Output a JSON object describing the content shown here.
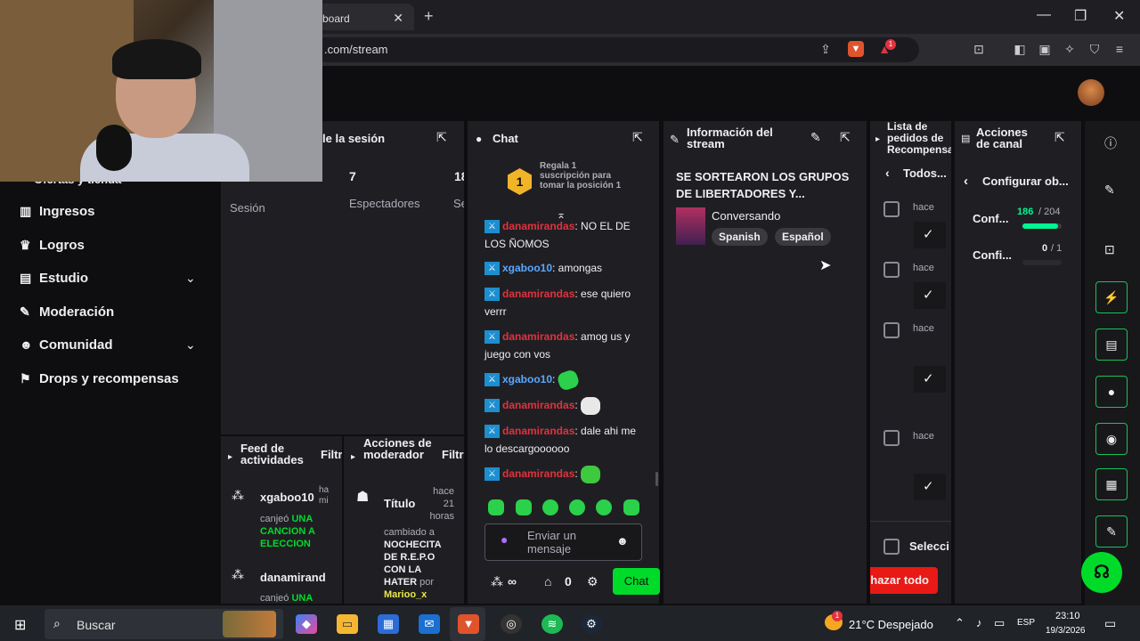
{
  "browser": {
    "tab_title": "board",
    "tab_close": "✕",
    "new_tab": "+",
    "url": ".com/stream",
    "window_controls": [
      "—",
      "❐",
      "✕"
    ],
    "shield_badge": "",
    "alert_badge": "1"
  },
  "sidebar": {
    "cut_item": "Ofertas y tienda",
    "items": [
      {
        "label": "Ingresos",
        "icon": "bar-chart-icon"
      },
      {
        "label": "Logros",
        "icon": "trophy-icon"
      },
      {
        "label": "Estudio",
        "icon": "studio-icon",
        "expandable": true
      },
      {
        "label": "Moderación",
        "icon": "wrench-icon"
      },
      {
        "label": "Comunidad",
        "icon": "community-icon",
        "expandable": true
      },
      {
        "label": "Drops y recompensas",
        "icon": "drops-icon"
      }
    ]
  },
  "session_panel": {
    "title": "le la sesión",
    "stats": [
      {
        "value": "7",
        "label": "Espectadores"
      },
      {
        "value": "18",
        "label": "Se"
      }
    ],
    "label_left": "Sesión"
  },
  "chat_panel": {
    "title": "Chat",
    "gift_text": "Regala 1 suscripción para tomar la posición 1",
    "gift_rank": "1",
    "messages": [
      {
        "user": "danamirandas",
        "text": ": NO EL DE LOS ÑOMOS",
        "color": "red"
      },
      {
        "user": "xgaboo10",
        "text": ": amongas",
        "color": "blue"
      },
      {
        "user": "danamirandas",
        "text": ": ese quiero verrr",
        "color": "red"
      },
      {
        "user": "danamirandas",
        "text": ": amog us y juego con vos",
        "color": "red"
      },
      {
        "user": "xgaboo10",
        "text": ":",
        "color": "blue"
      },
      {
        "user": "danamirandas",
        "text": ":",
        "color": "red"
      },
      {
        "user": "danamirandas",
        "text": ": dale ahi me lo descargoooooo",
        "color": "red"
      },
      {
        "user": "danamirandas",
        "text": ":",
        "color": "red"
      }
    ],
    "input_placeholder": "Enviar un mensaje",
    "points": "∞",
    "store_count": "0",
    "send_label": "Chat"
  },
  "stream_info": {
    "title": "Información del stream",
    "stream_title": "SE SORTEARON LOS GRUPOS DE LIBERTADORES Y...",
    "category": "Conversando",
    "tags": [
      "Spanish",
      "Español"
    ]
  },
  "requests_panel": {
    "title": "Lista de pedidos de Recompensas",
    "filter": "Todos...",
    "rows": [
      "hace",
      "hace",
      "hace",
      "hace"
    ],
    "select_label": "Selecci",
    "reject_all": "hazar todo"
  },
  "channel_actions": {
    "title": "Acciones de canal",
    "back_label": "Configurar ob...",
    "goals": [
      {
        "label": "Conf...",
        "current": "186",
        "total": "/ 204",
        "progress": 0.91
      },
      {
        "label": "Confi...",
        "current": "0",
        "total": "/ 1",
        "progress": 0
      }
    ]
  },
  "activity_feed": {
    "title": "Feed de actividades",
    "filter": "Filtr",
    "items": [
      {
        "user": "xgaboo10",
        "time": "ha mi",
        "action": "canjeó",
        "reward": "UNA CANCION A ELECCION"
      },
      {
        "user": "danamirand",
        "time": "",
        "action": "canjeó",
        "reward": "UNA"
      }
    ]
  },
  "mod_actions": {
    "title": "Acciones de moderador",
    "filter": "Filtr",
    "item": {
      "field": "Título",
      "time": "hace 21 horas",
      "change_prefix": "cambiado a",
      "new_value": "NOCHECITA DE R.E.P.O CON LA HATER",
      "by": "por",
      "mod": "Marioo_x"
    }
  },
  "taskbar": {
    "search": "Buscar",
    "weather": "21°C Despejado",
    "lang": "ESP",
    "time": "23:10",
    "date": "19/3/2026",
    "notif_count": "1"
  },
  "colors": {
    "accent": "#00f593",
    "green_button": "#00db2a",
    "reject": "#e91916",
    "rail_border": "#16c25a"
  }
}
